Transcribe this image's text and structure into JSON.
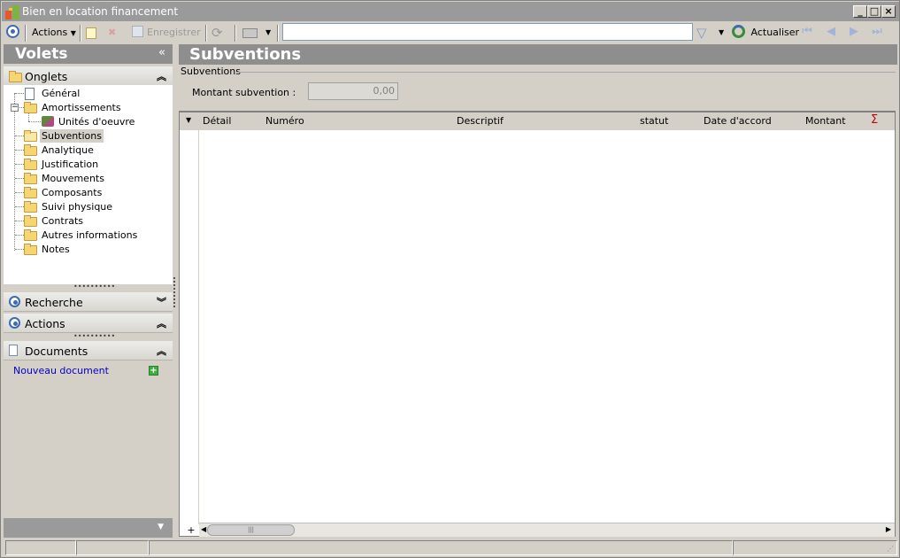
{
  "window": {
    "title": "Bien en location financement",
    "minimize": "_",
    "maximize": "□",
    "close": "×"
  },
  "toolbar": {
    "actions_label": "Actions",
    "save_label": "Enregistrer",
    "search_value": "",
    "refresh_label": "Actualiser"
  },
  "left": {
    "header": "Volets",
    "collapse_glyph": "«",
    "onglets": {
      "label": "Onglets",
      "items": [
        {
          "label": "Général"
        },
        {
          "label": "Amortissements"
        },
        {
          "label": "Unités d'oeuvre"
        },
        {
          "label": "Subventions"
        },
        {
          "label": "Analytique"
        },
        {
          "label": "Justification"
        },
        {
          "label": "Mouvements"
        },
        {
          "label": "Composants"
        },
        {
          "label": "Suivi physique"
        },
        {
          "label": "Contrats"
        },
        {
          "label": "Autres informations"
        },
        {
          "label": "Notes"
        }
      ]
    },
    "recherche": {
      "label": "Recherche"
    },
    "actions": {
      "label": "Actions"
    },
    "documents": {
      "label": "Documents",
      "new_document": "Nouveau document"
    }
  },
  "main": {
    "title": "Subventions",
    "group_label": "Subventions",
    "field_label": "Montant subvention :",
    "field_value": "0,00",
    "grid": {
      "columns": [
        "Détail",
        "Numéro",
        "Descriptif",
        "statut",
        "Date d'accord",
        "Montant"
      ],
      "sigma": "Σ",
      "plus": "+"
    }
  },
  "colors": {
    "header_bg": "#8e8e8e",
    "accent_blue": "#3d6bb3",
    "link": "#0000cc"
  }
}
